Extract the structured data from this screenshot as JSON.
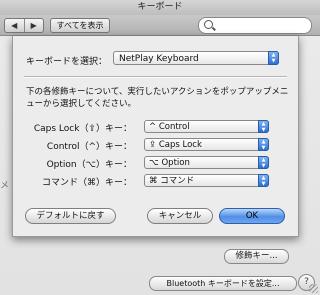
{
  "window": {
    "title": "キーボード"
  },
  "toolbar": {
    "back": "◀",
    "forward": "▶",
    "show_all": "すべてを表示",
    "search_placeholder": ""
  },
  "sheet": {
    "keyboard_label": "キーボードを選択：",
    "keyboard_value": "NetPlay Keyboard",
    "description": "下の各修飾キーについて、実行したいアクションをポップアップメニューから選択してください。",
    "rows": [
      {
        "label": "Caps Lock（⇪）キー：",
        "value": "^ Control"
      },
      {
        "label": "Control（^）キー：",
        "value": "⇪ Caps Lock"
      },
      {
        "label": "Option（⌥）キー：",
        "value": "⌥ Option"
      },
      {
        "label": "コマンド（⌘）キー：",
        "value": "⌘ コマンド"
      }
    ],
    "default_button": "デフォルトに戻す",
    "cancel_button": "キャンセル",
    "ok_button": "OK"
  },
  "background": {
    "modifier_button": "修飾キー...",
    "bluetooth_button": "Bluetooth キーボードを設定...",
    "help": "?",
    "partial_text": "メ"
  },
  "colors": {
    "accent": "#4f8fe6"
  }
}
